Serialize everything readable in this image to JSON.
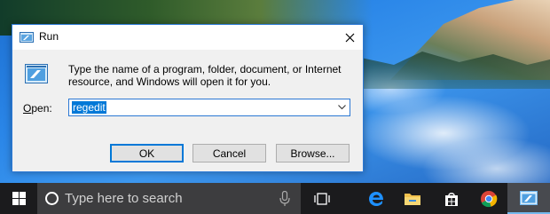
{
  "dialog": {
    "title": "Run",
    "prompt": "Type the name of a program, folder, document, or Internet resource, and Windows will open it for you.",
    "open_label_prefix": "O",
    "open_label_rest": "pen:",
    "open_value": "regedit",
    "buttons": {
      "ok": "OK",
      "cancel": "Cancel",
      "browse": "Browse..."
    },
    "icons": {
      "title": "run-icon",
      "prompt": "run-icon",
      "close": "close-icon",
      "dropdown": "chevron-down-icon"
    }
  },
  "taskbar": {
    "search_placeholder": "Type here to search",
    "icons": [
      "windows-start-icon",
      "cortana-icon",
      "microphone-icon",
      "task-view-icon",
      "edge-icon",
      "file-explorer-icon",
      "store-icon",
      "chrome-icon",
      "run-icon"
    ]
  },
  "colors": {
    "accent": "#0078d7",
    "taskbar": "#1b1b1d",
    "search_box": "#3d3d3f"
  }
}
